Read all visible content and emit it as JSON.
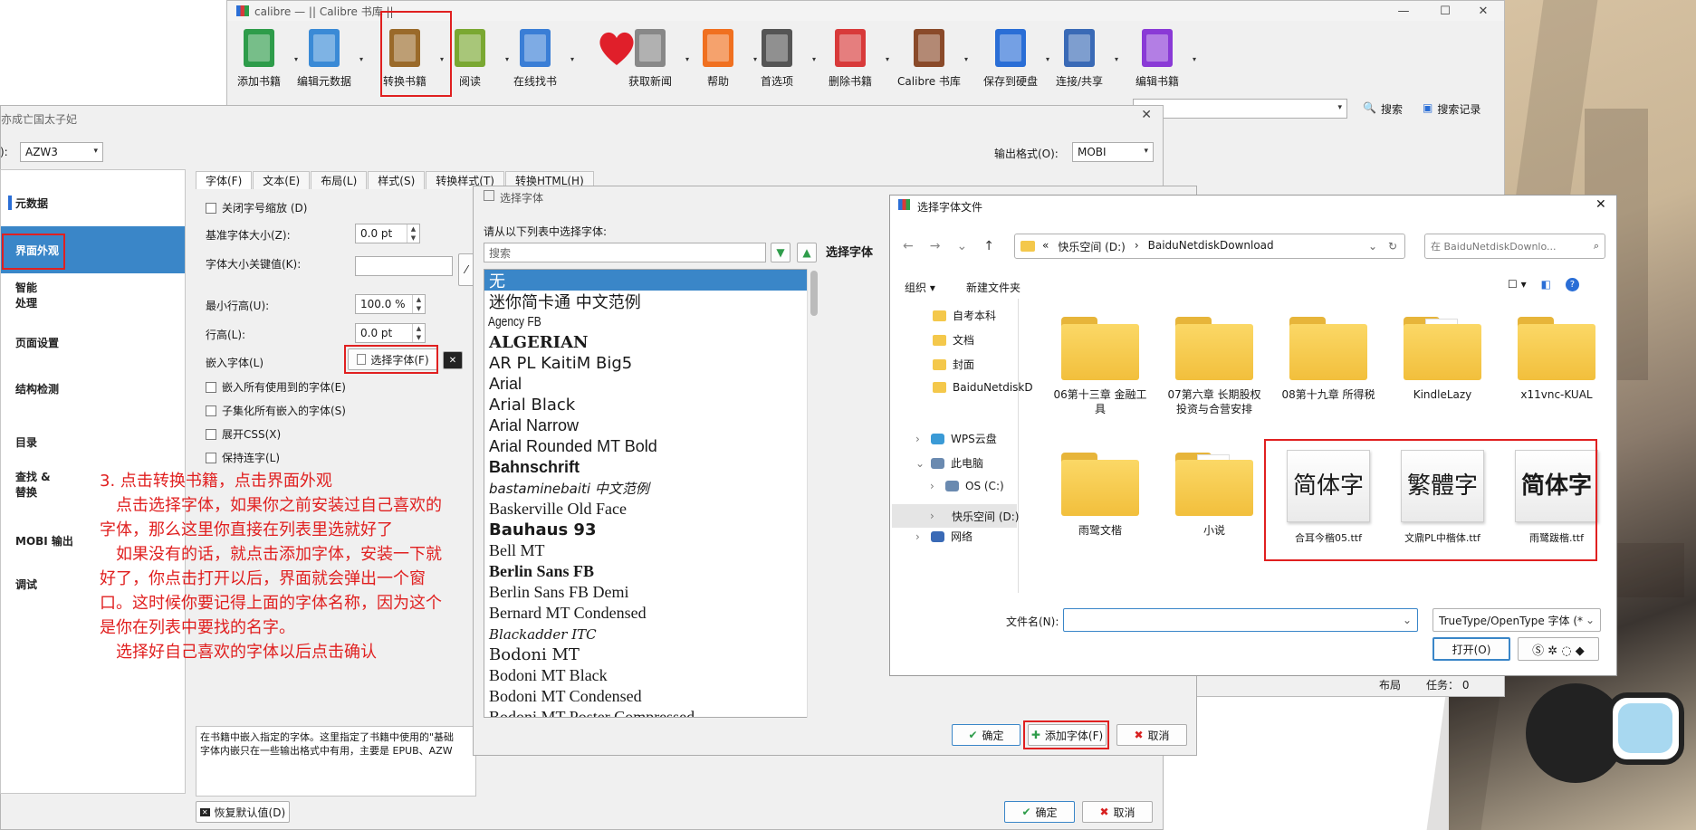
{
  "main_window": {
    "title": "calibre — || Calibre 书库 ||",
    "toolbar": [
      {
        "label": "添加书籍",
        "icon": "add-book-icon",
        "color": "#2e9c4a"
      },
      {
        "label": "编辑元数据",
        "icon": "edit-metadata-icon",
        "color": "#3a8ad6"
      },
      {
        "label": "转换书籍",
        "icon": "convert-book-icon",
        "color": "#9a6a2a"
      },
      {
        "label": "阅读",
        "icon": "read-book-icon",
        "color": "#7aa832"
      },
      {
        "label": "在线找书",
        "icon": "download-books-icon",
        "color": "#3a7ed6"
      },
      {
        "label": "",
        "icon": "heart-icon",
        "color": "#e01f2a"
      },
      {
        "label": "获取新闻",
        "icon": "news-icon",
        "color": "#888888"
      },
      {
        "label": "帮助",
        "icon": "help-lifebuoy-icon",
        "color": "#f07020"
      },
      {
        "label": "首选项",
        "icon": "preferences-tools-icon",
        "color": "#555555"
      },
      {
        "label": "删除书籍",
        "icon": "remove-book-icon",
        "color": "#d83a3a"
      },
      {
        "label": "Calibre 书库",
        "icon": "library-books-icon",
        "color": "#8a4a2a"
      },
      {
        "label": "保存到硬盘",
        "icon": "save-disk-icon",
        "color": "#2a6ed6"
      },
      {
        "label": "连接/共享",
        "icon": "connect-share-icon",
        "color": "#3a6ab6"
      },
      {
        "label": "编辑书籍",
        "icon": "edit-book-icon",
        "color": "#8a3ad6"
      }
    ],
    "search_label": "搜索",
    "saved_search_label": "搜索记录",
    "status_layout": "布局",
    "status_jobs": "任务：  0"
  },
  "convert_dialog": {
    "title_partial": "亦成亡国太子妃",
    "input_format_label": "):",
    "input_format": "AZW3",
    "output_format_label": "输出格式(O):",
    "output_format": "MOBI",
    "sidebar": [
      "元数据",
      "界面外观",
      "智能\n处理",
      "页面设置",
      "结构检测",
      "目录",
      "查找 &\n替换",
      "MOBI 输出",
      "调试"
    ],
    "tabs": [
      "字体(F)",
      "文本(E)",
      "布局(L)",
      "样式(S)",
      "转换样式(T)",
      "转换HTML(H)"
    ],
    "disable_font_scaling": "关闭字号缩放 (D)",
    "base_font_size_label": "基准字体大小(Z):",
    "base_font_size_value": "0.0 pt",
    "font_size_key_label": "字体大小关键值(K):",
    "min_line_height_label": "最小行高(U):",
    "min_line_height_value": "100.0 %",
    "line_height_label": "行高(L):",
    "line_height_value": "0.0 pt",
    "embed_font_label": "嵌入字体(L)",
    "choose_font_button": "选择字体(F)",
    "embed_all_fonts": "嵌入所有使用到的字体(E)",
    "subset_fonts": "子集化所有嵌入的字体(S)",
    "expand_css": "展开CSS(X)",
    "keep_ligatures": "保持连字(L)",
    "help_text_1": "在书籍中嵌入指定的字体。这里指定了书籍中使用的\"基础",
    "help_text_2": "字体内嵌只在一些输出格式中有用，主要是 EPUB、AZW",
    "restore_defaults": "恢复默认值(D)",
    "ok": "确定",
    "cancel": "取消"
  },
  "note": [
    "3. 点击转换书籍，点击界面外观",
    "　点击选择字体，如果你之前安装过自己喜欢的字体，那么这里你直接在列表里选就好了",
    "　如果没有的话，就点击添加字体，安装一下就好了，你点击打开以后，界面就会弹出一个窗口。这时候你要记得上面的字体名称，因为这个是你在列表中要找的名字。",
    "　选择好自己喜欢的字体以后点击确认"
  ],
  "font_dialog": {
    "title": "选择字体",
    "prompt": "请从以下列表中选择字体:",
    "search_placeholder": "搜索",
    "preview_label": "选择字体",
    "fonts": [
      "无",
      "迷你简卡通 中文范例",
      "Agency FB",
      "ALGERIAN",
      "AR PL KaitiM Big5",
      "Arial",
      "Arial Black",
      "Arial Narrow",
      "Arial Rounded MT Bold",
      "Bahnschrift",
      "bastaminebaiti 中文范例",
      "Baskerville Old Face",
      "Bauhaus 93",
      "Bell MT",
      "Berlin Sans FB",
      "Berlin Sans FB Demi",
      "Bernard MT Condensed",
      "Blackadder ITC",
      "Bodoni MT",
      "Bodoni MT Black",
      "Bodoni MT Condensed",
      "Bodoni MT Poster Compressed"
    ],
    "ok": "确定",
    "add_font": "添加字体(F)",
    "cancel": "取消"
  },
  "file_dialog": {
    "title": "选择字体文件",
    "path": [
      "«",
      "快乐空间 (D:)",
      "›",
      "BaiduNetdiskDownload"
    ],
    "search_placeholder": "在 BaiduNetdiskDownlo...",
    "organize": "组织 ▾",
    "new_folder": "新建文件夹",
    "tree": [
      "自考本科",
      "文档",
      "封面",
      "BaiduNetdiskD",
      "WPS云盘",
      "此电脑",
      "OS (C:)",
      "快乐空间 (D:)",
      "网络"
    ],
    "folders": [
      "06第十三章 金融工具",
      "07第六章 长期股权投资与合营安排",
      "08第十九章 所得税",
      "KindleLazy",
      "x11vnc-KUAL",
      "雨鹭文楷",
      "小说"
    ],
    "font_files": [
      {
        "preview": "简体字",
        "name": "合耳今楷05.ttf"
      },
      {
        "preview": "繁體字",
        "name": "文鼎PL中楷体.ttf"
      },
      {
        "preview": "简体字",
        "name": "雨鹭跋楷.ttf"
      }
    ],
    "filename_label": "文件名(N):",
    "filetype": "TrueType/OpenType 字体 (*.",
    "open": "打开(O)"
  }
}
